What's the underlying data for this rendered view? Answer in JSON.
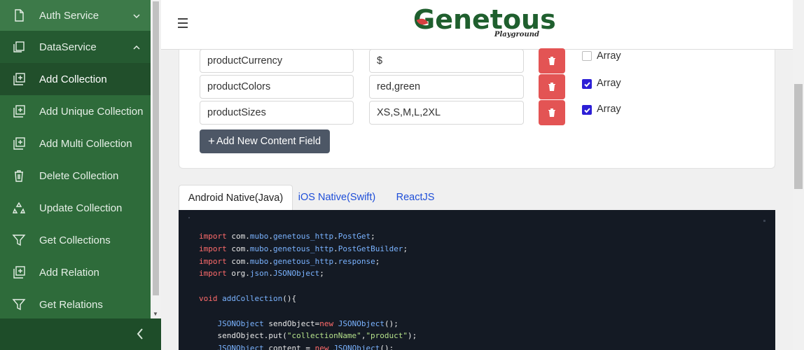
{
  "sidebar": {
    "items": [
      {
        "label": "Auth Service",
        "icon": "document-icon",
        "chevron": "down"
      },
      {
        "label": "DataService",
        "icon": "copy-icon",
        "chevron": "up"
      },
      {
        "label": "Add Collection",
        "icon": "add-box-icon"
      },
      {
        "label": "Add Unique Collection",
        "icon": "add-box-icon"
      },
      {
        "label": "Add Multi Collection",
        "icon": "add-box-icon"
      },
      {
        "label": "Delete Collection",
        "icon": "trash-icon"
      },
      {
        "label": "Update Collection",
        "icon": "recycle-icon"
      },
      {
        "label": "Get Collections",
        "icon": "filter-icon"
      },
      {
        "label": "Add Relation",
        "icon": "add-box-icon"
      },
      {
        "label": "Get Relations",
        "icon": "filter-icon"
      }
    ]
  },
  "header": {
    "logo_main": "Genetous",
    "logo_sub": "Playground"
  },
  "form": {
    "rows": [
      {
        "name": "productCurrency",
        "value": "$",
        "array_label": "Array",
        "array_checked": false
      },
      {
        "name": "productColors",
        "value": "red,green",
        "array_label": "Array",
        "array_checked": true
      },
      {
        "name": "productSizes",
        "value": "XS,S,M,L,2XL",
        "array_label": "Array",
        "array_checked": true
      }
    ],
    "add_button_label": "Add New Content Field"
  },
  "tabs": [
    {
      "label": "Android Native(Java)",
      "active": true
    },
    {
      "label": "iOS Native(Swift)",
      "active": false
    },
    {
      "label": "ReactJS",
      "active": false
    }
  ],
  "code": {
    "lines": [
      "import com.mubo.genetous_http.PostGet;",
      "import com.mubo.genetous_http.PostGetBuilder;",
      "import com.mubo.genetous_http.response;",
      "import org.json.JSONObject;",
      "",
      "void addCollection(){",
      "",
      "    JSONObject sendObject=new JSONObject();",
      "    sendObject.put(\"collectionName\",\"product\");",
      "    JSONObject content = new JSONObject();"
    ]
  },
  "colors": {
    "sidebar_bg": "#2e6b3a",
    "sidebar_active": "#214f2b",
    "delete_button": "#e35454",
    "checkbox_checked": "#2c1fd6",
    "tab_link": "#1e4ed8",
    "code_bg": "#141a24"
  }
}
